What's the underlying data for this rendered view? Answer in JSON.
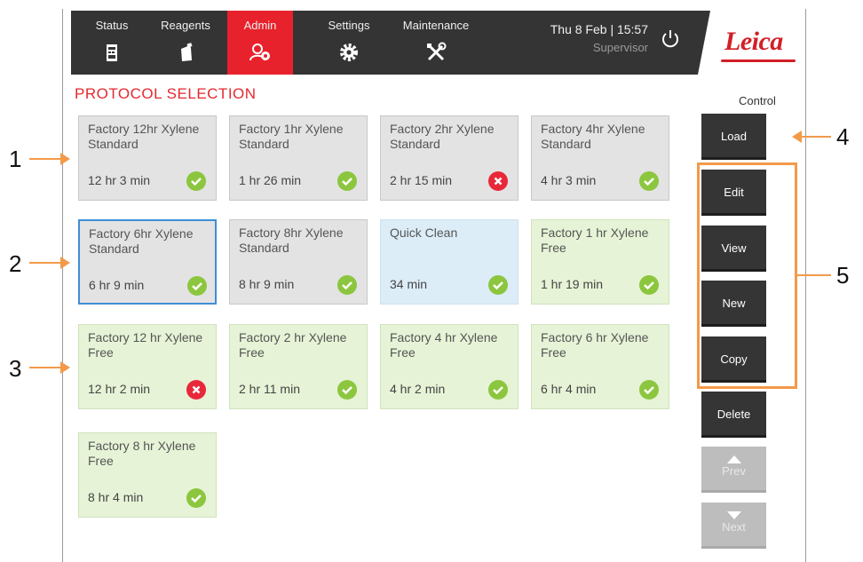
{
  "topbar": {
    "tabs": [
      {
        "label": "Status",
        "icon": "instrument-icon"
      },
      {
        "label": "Reagents",
        "icon": "reagent-bottle-icon"
      },
      {
        "label": "Admin",
        "icon": "admin-users-icon",
        "active": true
      },
      {
        "label": "Settings",
        "icon": "gear-icon"
      },
      {
        "label": "Maintenance",
        "icon": "tools-icon"
      }
    ],
    "datetime": "Thu 8 Feb | 15:57",
    "user": "Supervisor",
    "logo": "Leica"
  },
  "page": {
    "title": "PROTOCOL SELECTION",
    "control_label": "Control"
  },
  "protocols": [
    {
      "name": "Factory 12hr Xylene Standard",
      "duration": "12 hr 3 min",
      "status": "valid",
      "type": "standard"
    },
    {
      "name": "Factory 1hr Xylene Standard",
      "duration": "1 hr 26 min",
      "status": "valid",
      "type": "standard"
    },
    {
      "name": "Factory 2hr Xylene Standard",
      "duration": "2 hr 15 min",
      "status": "invalid",
      "type": "standard"
    },
    {
      "name": "Factory 4hr Xylene Standard",
      "duration": "4 hr 3 min",
      "status": "valid",
      "type": "standard"
    },
    {
      "name": "Factory 6hr Xylene Standard",
      "duration": "6 hr 9 min",
      "status": "valid",
      "type": "standard",
      "selected": true
    },
    {
      "name": "Factory 8hr Xylene Standard",
      "duration": "8 hr 9 min",
      "status": "valid",
      "type": "standard"
    },
    {
      "name": "Quick Clean",
      "duration": "34 min",
      "status": "valid",
      "type": "clean"
    },
    {
      "name": "Factory 1 hr Xylene Free",
      "duration": "1 hr 19 min",
      "status": "valid",
      "type": "free"
    },
    {
      "name": "Factory 12 hr Xylene Free",
      "duration": "12 hr 2 min",
      "status": "invalid",
      "type": "free"
    },
    {
      "name": "Factory 2 hr Xylene Free",
      "duration": "2 hr 11 min",
      "status": "valid",
      "type": "free"
    },
    {
      "name": "Factory 4 hr Xylene Free",
      "duration": "4 hr 2 min",
      "status": "valid",
      "type": "free"
    },
    {
      "name": "Factory 6 hr Xylene Free",
      "duration": "6 hr 4 min",
      "status": "valid",
      "type": "free"
    },
    {
      "name": "Factory 8 hr Xylene Free",
      "duration": "8 hr 4 min",
      "status": "valid",
      "type": "free"
    }
  ],
  "controls": {
    "load": "Load",
    "edit": "Edit",
    "view": "View",
    "new": "New",
    "copy": "Copy",
    "delete": "Delete",
    "prev": "Prev",
    "next": "Next"
  },
  "callouts": [
    "1",
    "2",
    "3",
    "4",
    "5"
  ],
  "colors": {
    "accent_red": "#e8222c",
    "callout_orange": "#f39a4a",
    "status_ok": "#8cc63f",
    "status_error": "#e8283a",
    "selected_border": "#3f8ed6"
  }
}
